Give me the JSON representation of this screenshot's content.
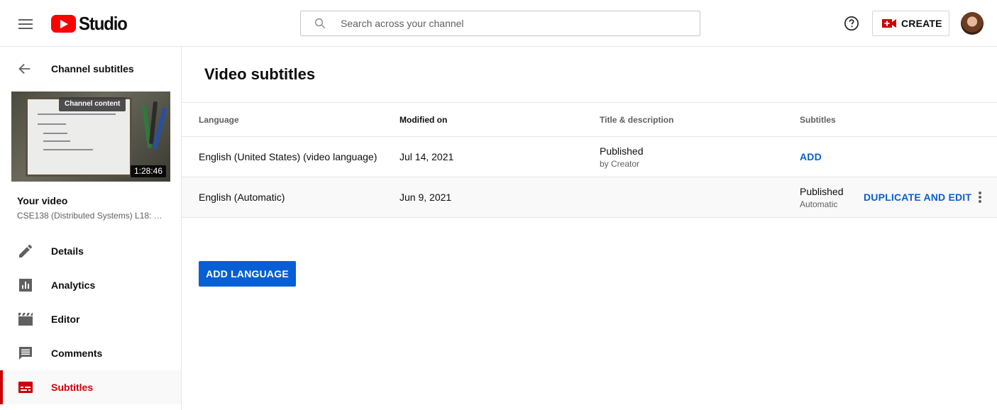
{
  "header": {
    "logo_text": "Studio",
    "search_placeholder": "Search across your channel",
    "create_label": "CREATE",
    "icons": [
      "menu-icon",
      "youtube-logo",
      "search-icon",
      "help-icon",
      "create-video-icon",
      "avatar"
    ]
  },
  "sidebar": {
    "back_title": "Channel subtitles",
    "thumbnail": {
      "chip": "Channel content",
      "duration": "1:28:46"
    },
    "your_video_label": "Your video",
    "video_title": "CSE138 (Distributed Systems) L18: …",
    "items": [
      {
        "label": "Details",
        "icon": "pencil-icon",
        "active": false
      },
      {
        "label": "Analytics",
        "icon": "analytics-icon",
        "active": false
      },
      {
        "label": "Editor",
        "icon": "clapperboard-icon",
        "active": false
      },
      {
        "label": "Comments",
        "icon": "comments-icon",
        "active": false
      },
      {
        "label": "Subtitles",
        "icon": "subtitles-icon",
        "active": true
      }
    ]
  },
  "main": {
    "title": "Video subtitles",
    "columns": [
      "Language",
      "Modified on",
      "Title & description",
      "Subtitles"
    ],
    "rows": [
      {
        "language": "English (United States) (video language)",
        "modified": "Jul 14, 2021",
        "title_status": "Published",
        "title_by": "by Creator",
        "subtitles_action": "ADD"
      },
      {
        "language": "English (Automatic)",
        "modified": "Jun 9, 2021",
        "subtitles_status": "Published",
        "subtitles_by": "Automatic",
        "subtitles_action": "DUPLICATE AND EDIT"
      }
    ],
    "add_language_label": "ADD LANGUAGE"
  },
  "colors": {
    "brand_red": "#ff0000",
    "active_red": "#cc0000",
    "link_blue": "#065fd4",
    "text_secondary": "#606060"
  }
}
